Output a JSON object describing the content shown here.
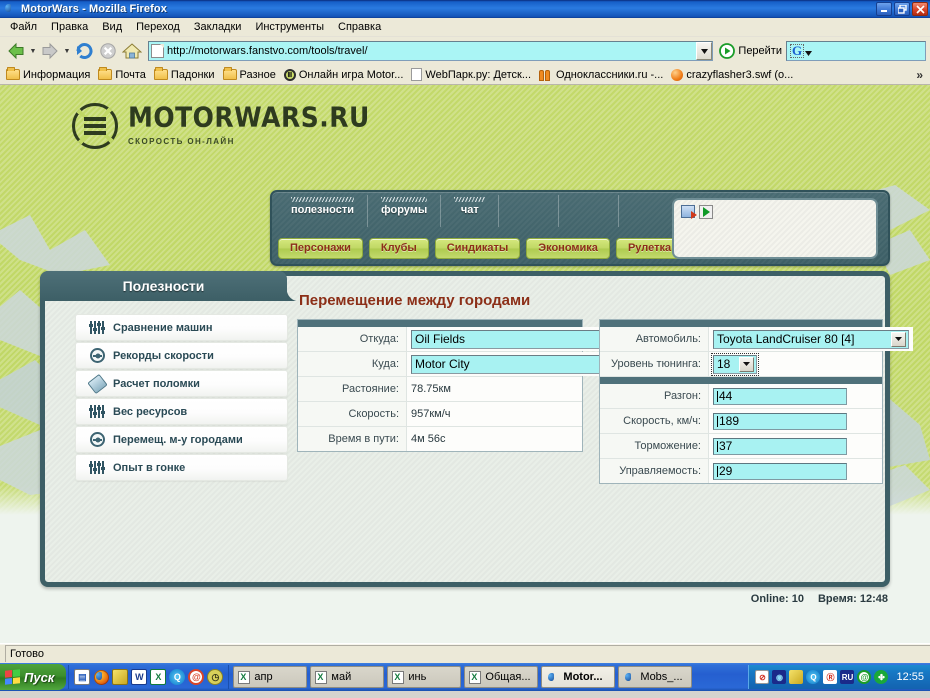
{
  "window": {
    "title": "MotorWars - Mozilla Firefox",
    "icon": "firefox-icon",
    "minimize": "minimize-button",
    "maximize": "restore-button",
    "close": "close-button"
  },
  "menubar": {
    "items": [
      {
        "label": "Файл"
      },
      {
        "label": "Правка"
      },
      {
        "label": "Вид"
      },
      {
        "label": "Переход"
      },
      {
        "label": "Закладки"
      },
      {
        "label": "Инструменты"
      },
      {
        "label": "Справка"
      }
    ]
  },
  "toolbar": {
    "back": "back-button",
    "forward": "forward-button",
    "reload": "reload-button",
    "stop": "stop-button",
    "home": "home-button",
    "url": "http://motorwars.fanstvo.com/tools/travel/",
    "go_label": "Перейти",
    "search_value": "G",
    "search_placeholder": ""
  },
  "bookmarks": {
    "items": [
      {
        "label": "Информация",
        "icon": "folder-icon"
      },
      {
        "label": "Почта",
        "icon": "folder-icon"
      },
      {
        "label": "Падонки",
        "icon": "folder-icon"
      },
      {
        "label": "Разное",
        "icon": "folder-icon"
      },
      {
        "label": "Онлайн игра Motor...",
        "icon": "motorwars-icon"
      },
      {
        "label": "WebПарк.ру: Детск...",
        "icon": "document-icon"
      },
      {
        "label": "Одноклассники.ru -...",
        "icon": "people-icon"
      },
      {
        "label": "crazyflasher3.swf (о...",
        "icon": "flash-icon"
      }
    ],
    "overflow": "»"
  },
  "site": {
    "logo": {
      "name": "MOTORWARS.RU",
      "tagline": "СКОРОСТЬ ОН-ЛАЙН"
    },
    "nav_tabs": [
      {
        "label": "полезности"
      },
      {
        "label": "форумы"
      },
      {
        "label": "чат"
      }
    ],
    "nav_buttons": [
      {
        "label": "Персонажи"
      },
      {
        "label": "Клубы"
      },
      {
        "label": "Синдикаты"
      },
      {
        "label": "Экономика"
      },
      {
        "label": "Рулетка"
      }
    ],
    "userbox": {
      "icon1": "logout-icon",
      "icon2": "enter-icon"
    },
    "sidebar": {
      "title": "Полезности",
      "items": [
        {
          "label": "Сравнение машин",
          "icon": "sliders-icon"
        },
        {
          "label": "Рекорды скорости",
          "icon": "steering-wheel-icon"
        },
        {
          "label": "Расчет поломки",
          "icon": "wrench-icon"
        },
        {
          "label": "Вес ресурсов",
          "icon": "sliders-icon"
        },
        {
          "label": "Перемещ. м-у городами",
          "icon": "steering-wheel-icon"
        },
        {
          "label": "Опыт в гонке",
          "icon": "sliders-icon"
        }
      ]
    },
    "main": {
      "title": "Перемещение между городами",
      "travel_form": {
        "rows": [
          {
            "label": "Откуда:",
            "value": "Oil Fields",
            "type": "select"
          },
          {
            "label": "Куда:",
            "value": "Motor City",
            "type": "select"
          },
          {
            "label": "Растояние:",
            "value": "78.75км",
            "type": "text"
          },
          {
            "label": "Скорость:",
            "value": "957км/ч",
            "type": "text"
          },
          {
            "label": "Время в пути:",
            "value": "4м 56с",
            "type": "text"
          }
        ]
      },
      "car_form": {
        "rows": [
          {
            "label": "Автомобиль:",
            "value": "Toyota LandCruiser 80 [4]",
            "type": "select"
          },
          {
            "label": "Уровень тюнинга:",
            "value": "18",
            "type": "select"
          }
        ]
      },
      "stats_form": {
        "rows": [
          {
            "label": "Разгон:",
            "value": "44",
            "type": "input"
          },
          {
            "label": "Скорость, км/ч:",
            "value": "189",
            "type": "input"
          },
          {
            "label": "Торможение:",
            "value": "37",
            "type": "input"
          },
          {
            "label": "Управляемость:",
            "value": "29",
            "type": "input"
          }
        ]
      }
    },
    "status": {
      "online": "Online: 10",
      "time": "Время: 12:48"
    }
  },
  "browser_status": {
    "text": "Готово"
  },
  "taskbar": {
    "start_label": "Пуск",
    "quick_launch": [
      {
        "name": "show-desktop-icon"
      },
      {
        "name": "firefox-icon"
      },
      {
        "name": "winamp-icon"
      },
      {
        "name": "word-icon"
      },
      {
        "name": "excel-icon"
      },
      {
        "name": "quicktime-icon"
      },
      {
        "name": "outlook-icon"
      },
      {
        "name": "clock-icon"
      }
    ],
    "tasks": [
      {
        "label": "апр",
        "icon": "excel-icon",
        "active": false
      },
      {
        "label": "май",
        "icon": "excel-icon",
        "active": false
      },
      {
        "label": "инь",
        "icon": "excel-icon",
        "active": false
      },
      {
        "label": "Общая...",
        "icon": "excel-icon",
        "active": false
      },
      {
        "label": "Motor...",
        "icon": "firefox-icon",
        "active": true
      },
      {
        "label": "Mobs_...",
        "icon": "firefox-icon",
        "active": false
      }
    ],
    "tray": [
      {
        "name": "volume-muted-icon"
      },
      {
        "name": "speaker-icon"
      },
      {
        "name": "winamp-tray-icon"
      },
      {
        "name": "quicktime-tray-icon"
      },
      {
        "name": "antivirus-icon"
      },
      {
        "name": "keyboard-layout-ru-icon"
      },
      {
        "name": "mail-icon"
      },
      {
        "name": "clover-icon"
      }
    ],
    "clock": "12:55"
  },
  "colors": {
    "panel_dark": "#3d5f66",
    "accent_green": "#c0d864",
    "title_red": "#8c2f18",
    "input_cyan": "#a8f2f2"
  }
}
